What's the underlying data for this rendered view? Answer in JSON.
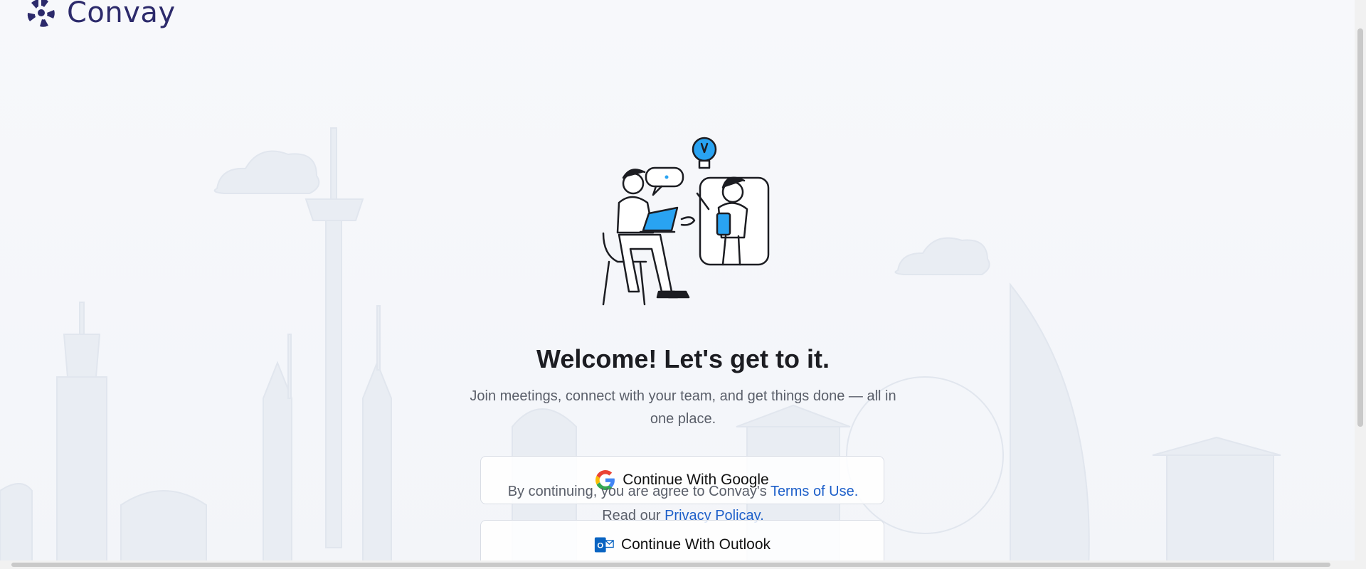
{
  "brand": {
    "name": "Convay",
    "color": "#2c2a6b"
  },
  "welcome": {
    "title": "Welcome! Let's get to it.",
    "subtitle": "Join meetings, connect with your team, and get things done — all in one place."
  },
  "auth": {
    "google_label": "Continue With Google",
    "google_icon": "google-icon",
    "outlook_label": "Continue With Outlook",
    "outlook_icon": "outlook-icon"
  },
  "legal": {
    "prefix": "By continuing, you are agree to Convay's",
    "terms_link": "Terms of Use.",
    "read_prefix": "Read our",
    "privacy_link": "Privacy Policay.",
    "link_color": "#1d5fc9"
  },
  "colors": {
    "accent": "#29a3f2",
    "text_primary": "#1c1d22",
    "text_secondary": "#5a5f6a"
  }
}
